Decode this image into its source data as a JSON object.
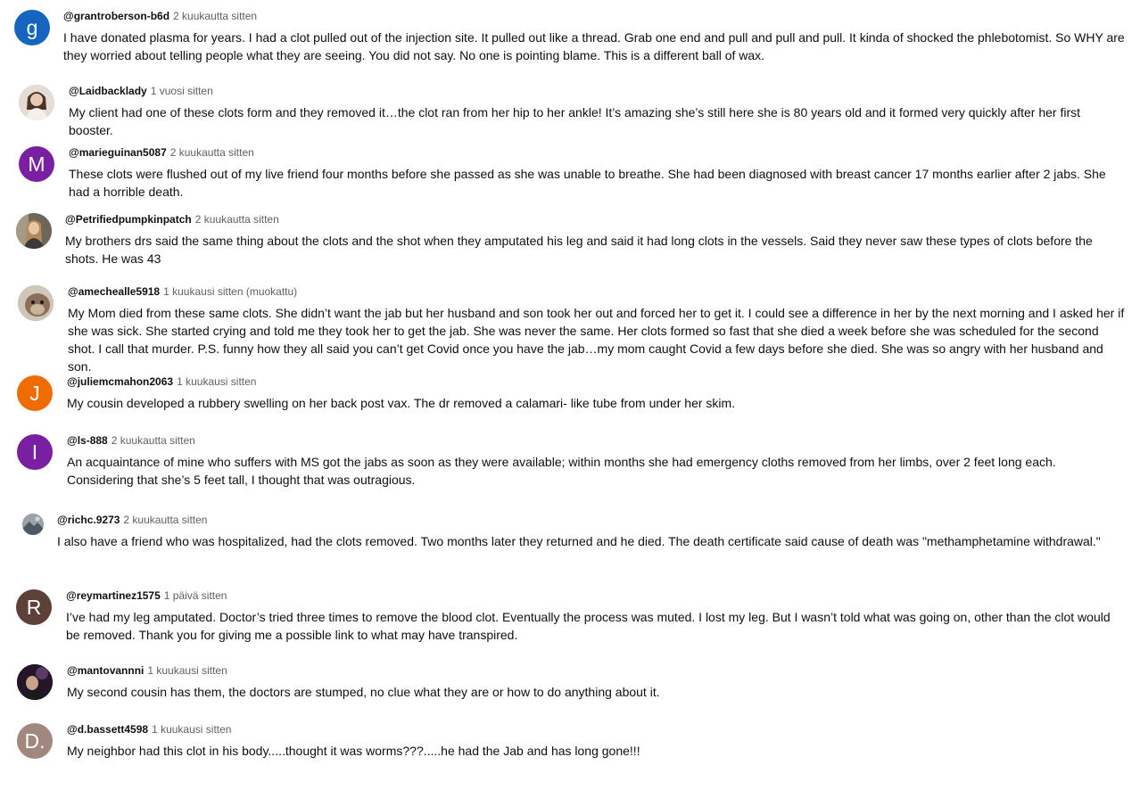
{
  "comments": [
    {
      "author": "@grantroberson-b6d",
      "time": "2 kuukautta sitten",
      "text": "I have donated plasma for years. I had a clot pulled out of the injection site. It pulled out like a thread. Grab one end and pull and pull and pull. It kinda of shocked the phlebotomist. So WHY are they worried about telling people what they are seeing. You did not say. No one is pointing blame. This is a different ball of wax.",
      "avatar": {
        "type": "letter",
        "letter": "g",
        "color": "#1565c0"
      }
    },
    {
      "author": "@Laidbacklady",
      "time": "1 vuosi sitten",
      "text": "My client had one of these clots form and they removed it…the clot ran from her hip to her ankle! It’s amazing she’s still here she is 80 years old and it formed very quickly after her first booster.",
      "avatar": {
        "type": "photo",
        "icon": "person-photo-icon",
        "color": "#c9bfb3"
      }
    },
    {
      "author": "@marieguinan5087",
      "time": "2 kuukautta sitten",
      "text": "These clots were flushed out of my live friend four months before she passed as she was unable to breathe. She had been diagnosed with breast cancer 17 months earlier after 2 jabs. She had a horrible death.",
      "avatar": {
        "type": "letter",
        "letter": "M",
        "color": "#7b1fa2"
      }
    },
    {
      "author": "@Petrifiedpumpkinpatch",
      "time": "2 kuukautta sitten",
      "text": "My brothers drs said the same thing about the clots and the shot when they amputated his leg and said it had long clots in the vessels. Said they never saw these types of clots before the shots.  He was 43",
      "avatar": {
        "type": "photo",
        "icon": "person-photo-icon",
        "color": "#8a7a66"
      }
    },
    {
      "author": "@amechealle5918",
      "time": "1 kuukausi sitten (muokattu)",
      "text": "My Mom died from these same clots. She didn’t want the jab but her husband and son took her out and forced her to get it. I could see a difference in her by the next morning and I asked her if she was sick. She started crying and told me they took her to get the jab. She was never the same. Her clots formed so fast that she died a week before she was scheduled for the second shot. I call that murder. P.S. funny how they all said you can’t get Covid once you have the jab…my mom caught Covid a few days before she died. She was so angry with her husband and son.",
      "avatar": {
        "type": "photo",
        "icon": "animal-photo-icon",
        "color": "#9e8a76"
      }
    },
    {
      "author": "@juliemcmahon2063",
      "time": "1 kuukausi sitten",
      "text": "My cousin developed a rubbery swelling on her back post vax. The dr removed a calamari- like tube from under her skim.",
      "avatar": {
        "type": "letter",
        "letter": "J",
        "color": "#ef6c00"
      }
    },
    {
      "author": "@ls-888",
      "time": "2 kuukautta sitten",
      "text": "An acquaintance of mine who suffers with MS got the jabs as soon as they were available; within months she had emergency cloths removed from her limbs, over 2 feet long each.  Considering that she’s 5 feet tall, I  thought that was outragious.",
      "avatar": {
        "type": "letter",
        "letter": "I",
        "color": "#7b1fa2"
      }
    },
    {
      "author": "@richc.9273",
      "time": "2 kuukautta sitten",
      "text": "I also have a friend who was hospitalized, had the clots removed.  Two months later they returned and he died.  The death certificate said cause of death was \"methamphetamine withdrawal.\"",
      "avatar": {
        "type": "photo",
        "icon": "landscape-photo-icon",
        "color": "#7a8088"
      }
    },
    {
      "author": "@reymartinez1575",
      "time": "1 päivä sitten",
      "text": "I’ve had my leg amputated.  Doctor’s tried three times to remove the blood clot. Eventually the process was muted. I lost my leg. But I wasn’t told what was going on, other than the clot would be removed. Thank you for giving me a possible link to what may have transpired.",
      "avatar": {
        "type": "letter",
        "letter": "R",
        "color": "#5d4037"
      }
    },
    {
      "author": "@mantovannni",
      "time": "1 kuukausi sitten",
      "text": "My second cousin has them, the doctors are stumped, no clue what they are or how to do anything about it.",
      "avatar": {
        "type": "photo",
        "icon": "person-photo-icon",
        "color": "#2c1b33"
      }
    },
    {
      "author": "@d.bassett4598",
      "time": "1 kuukausi sitten",
      "text": "My neighbor had this clot in his body.....thought it was worms???.....he had the Jab and has long gone!!!",
      "avatar": {
        "type": "letter",
        "letter": "D.",
        "color": "#a1887f"
      }
    }
  ]
}
